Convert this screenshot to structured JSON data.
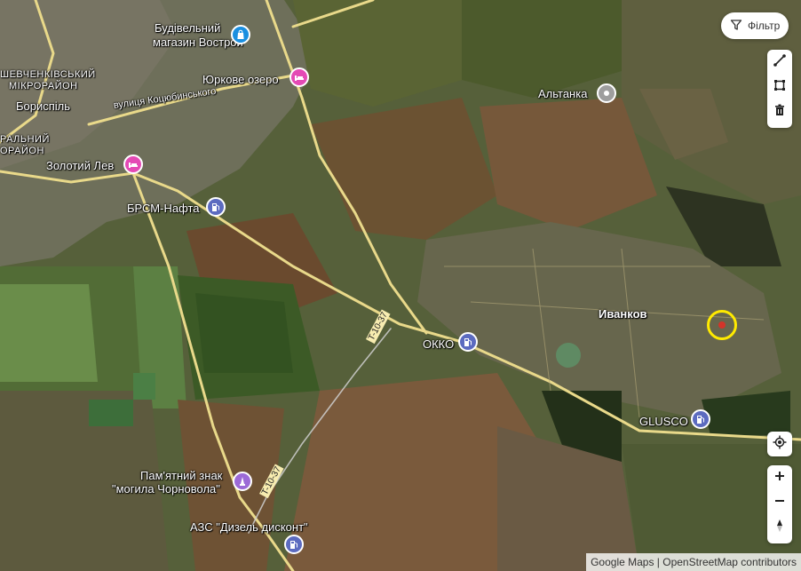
{
  "filter_button": {
    "label": "Фільтр"
  },
  "places": {
    "budivelnyi": [
      "Будівельний",
      "магазин Вострой"
    ],
    "yurkove": "Юркове озеро",
    "shevchenkivskyi": [
      "ШЕВЧЕНКІВСЬКИЙ",
      "МІКРОРАЙОН"
    ],
    "boryspil": "Бориспіль",
    "koczubynskoho": "вулиця Коцюбинського",
    "tsentralnyi": [
      "РАЛЬНИЙ",
      "ОРАЙОН"
    ],
    "zolotyi_lev": "Золотий Лев",
    "brsm": "БРСМ-Нафта",
    "altanka": "Альтанка",
    "ivankov": "Иванков",
    "okko": "ОККО",
    "glusco": "GLUSCO",
    "pamiatnyi": [
      "Пам'ятний знак",
      "\"могила Чорновола\""
    ],
    "azs": "АЗС \"Дизель дисконт\""
  },
  "roads": {
    "t1037_a": "T-10-37",
    "t1037_b": "T-10-37"
  },
  "poi_icons": {
    "budivelnyi": "shopping-bag-icon",
    "yurkove": "hotel-bed-icon",
    "zolotyi_lev": "hotel-bed-icon",
    "brsm": "gas-station-icon",
    "altanka": "place-dot-icon",
    "okko": "gas-station-icon",
    "glusco": "gas-station-icon",
    "pamiatnyi": "monument-icon",
    "azs": "gas-station-icon"
  },
  "colors": {
    "shop": "#1a8fe0",
    "hotel": "#e44ab5",
    "fuel": "#5c6bc0",
    "monument": "#9c6ad6",
    "place": "#9e9e9e",
    "marker_ring": "#ffea00",
    "marker_dot": "#d2342a"
  },
  "attribution": "Google Maps | OpenStreetMap contributors"
}
